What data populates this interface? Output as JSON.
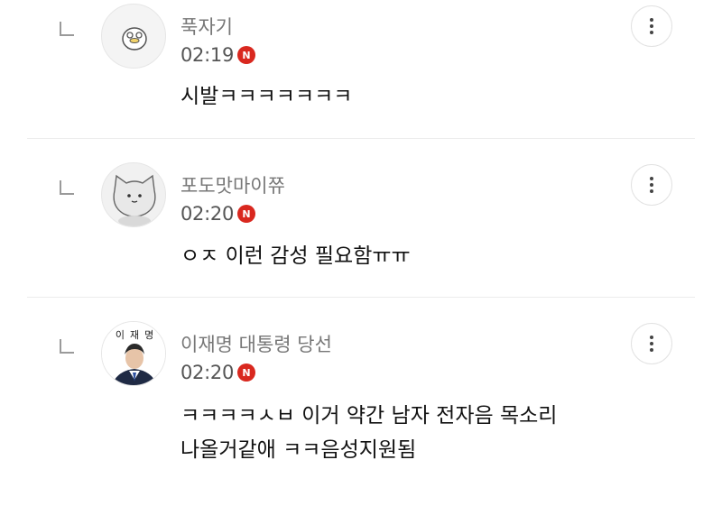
{
  "comments": [
    {
      "nickname": "푹자기",
      "time": "02:19",
      "badge": "N",
      "lines": [
        "시발ㅋㅋㅋㅋㅋㅋㅋ"
      ],
      "avatar_icon": "duck-character-icon"
    },
    {
      "nickname": "포도맛마이쮸",
      "time": "02:20",
      "badge": "N",
      "lines": [
        "ㅇㅈ 이런 감성 필요함ㅠㅠ"
      ],
      "avatar_icon": "cat-character-icon"
    },
    {
      "nickname": "이재명 대통령 당선",
      "time": "02:20",
      "badge": "N",
      "lines": [
        "ㅋㅋㅋㅋㅅㅂ 이거 약간 남자 전자음 목소리",
        "나올거같애 ㅋㅋ음성지원됨"
      ],
      "avatar_icon": "portrait-photo-icon",
      "avatar_text": [
        "이",
        "재",
        "명"
      ]
    }
  ],
  "colors": {
    "naver_badge": "#d9281f",
    "nickname": "#777777",
    "divider": "#ececec"
  }
}
